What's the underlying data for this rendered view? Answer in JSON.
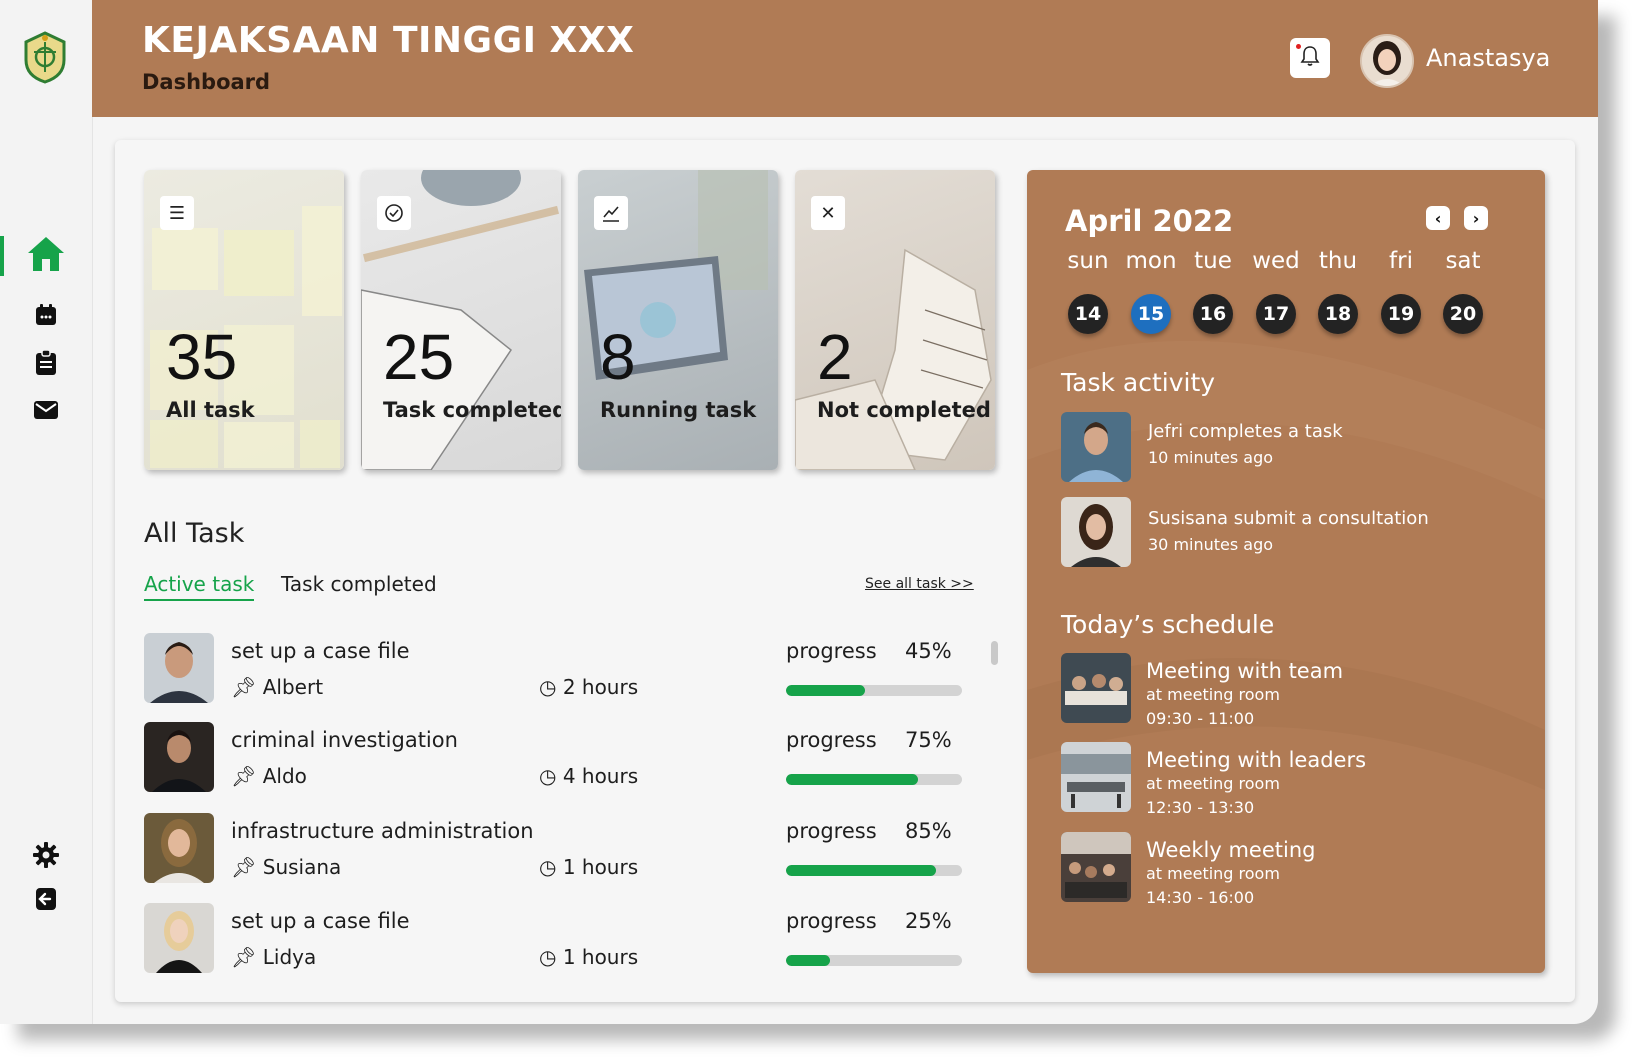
{
  "header": {
    "app_title": "KEJAKSAAN TINGGI XXX",
    "page_subtitle": "Dashboard",
    "user_name": "Anastasya"
  },
  "colors": {
    "brand": "#b07b55",
    "accent": "#16a34a",
    "selected_day": "#1e6fbf"
  },
  "sidebar": {
    "items": [
      {
        "name": "home",
        "icon": "home-icon",
        "active": true
      },
      {
        "name": "calendar",
        "icon": "calendar-icon",
        "active": false
      },
      {
        "name": "clipboard",
        "icon": "clipboard-icon",
        "active": false
      },
      {
        "name": "mail",
        "icon": "mail-icon",
        "active": false
      },
      {
        "name": "settings",
        "icon": "gear-icon",
        "active": false
      },
      {
        "name": "logout",
        "icon": "logout-icon",
        "active": false
      }
    ]
  },
  "stats": [
    {
      "value": "35",
      "label": "All task",
      "icon": "list-icon"
    },
    {
      "value": "25",
      "label": "Task completed",
      "icon": "check-circle-icon"
    },
    {
      "value": "8",
      "label": "Running task",
      "icon": "trend-chart-icon"
    },
    {
      "value": "2",
      "label": "Not completed",
      "icon": "close-icon"
    }
  ],
  "tasks_section": {
    "title": "All Task",
    "tabs": [
      "Active task",
      "Task completed"
    ],
    "see_all": "See all task >>",
    "progress_label": "progress"
  },
  "tasks": [
    {
      "title": "set up a case file",
      "person": "Albert",
      "duration": "2 hours",
      "progress_text": "45%",
      "progress": 0.45
    },
    {
      "title": "criminal investigation",
      "person": "Aldo",
      "duration": "4 hours",
      "progress_text": "75%",
      "progress": 0.75
    },
    {
      "title": "infrastructure administration",
      "person": "Susiana",
      "duration": "1 hours",
      "progress_text": "85%",
      "progress": 0.85
    },
    {
      "title": "set up a case file",
      "person": "Lidya",
      "duration": "1 hours",
      "progress_text": "25%",
      "progress": 0.25
    }
  ],
  "calendar": {
    "month": "April 2022",
    "day_names": [
      "sun",
      "mon",
      "tue",
      "wed",
      "thu",
      "fri",
      "sat"
    ],
    "days": [
      "14",
      "15",
      "16",
      "17",
      "18",
      "19",
      "20"
    ],
    "selected": "15"
  },
  "activity": {
    "title": "Task activity",
    "items": [
      {
        "text": "Jefri completes a task",
        "time": "10 minutes ago"
      },
      {
        "text": "Susisana submit a consultation",
        "time": "30 minutes ago"
      }
    ]
  },
  "schedule": {
    "title": "Today’s schedule",
    "items": [
      {
        "title": "Meeting with team",
        "place": "at meeting room",
        "time": "09:30 - 11:00"
      },
      {
        "title": "Meeting with leaders",
        "place": "at meeting room",
        "time": "12:30 - 13:30"
      },
      {
        "title": "Weekly meeting",
        "place": "at meeting room",
        "time": "14:30 - 16:00"
      }
    ]
  }
}
